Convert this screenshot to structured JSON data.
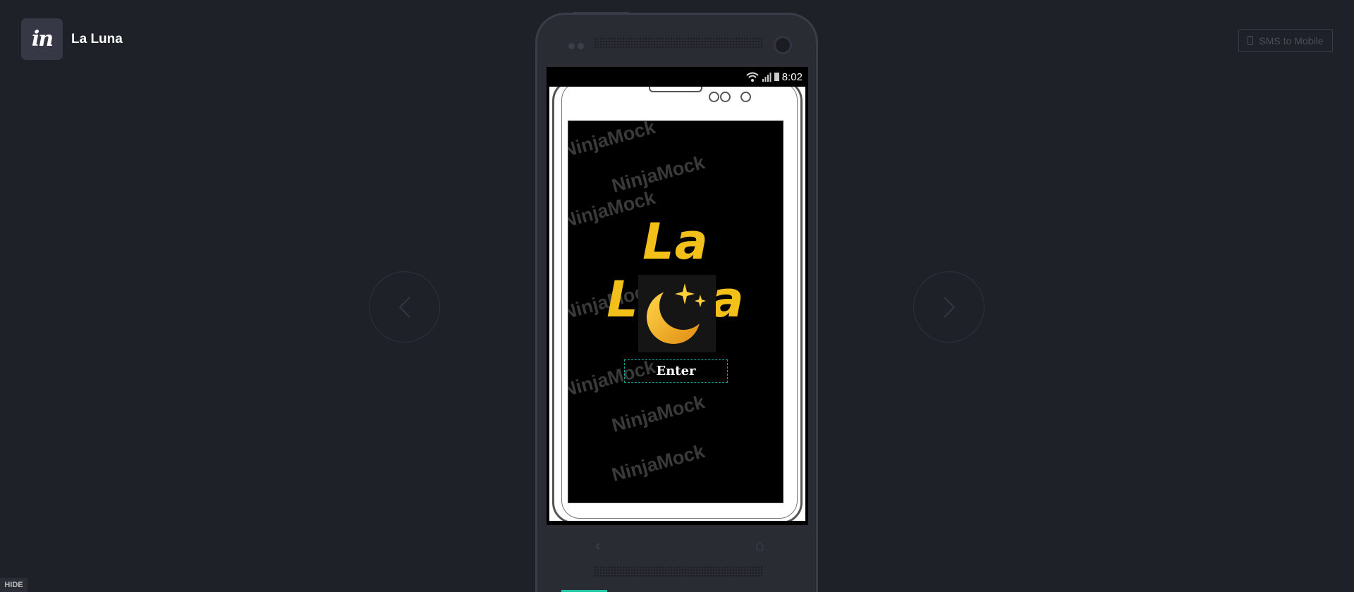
{
  "header": {
    "logo_text": "in",
    "project_title": "La Luna"
  },
  "toolbar": {
    "sms_label": "SMS to Mobile",
    "hide_label": "HIDE"
  },
  "nav": {
    "prev_icon": "chevron-left-icon",
    "next_icon": "chevron-right-icon"
  },
  "device": {
    "status_time": "8:02"
  },
  "app": {
    "title": "La Luna",
    "enter_label": "Enter",
    "watermark": "NinjaMock",
    "accent_color": "#f2c018"
  },
  "colors": {
    "background": "#1f2129",
    "progress": "#1ec8a5",
    "hotspot": "#1aa5a5"
  }
}
